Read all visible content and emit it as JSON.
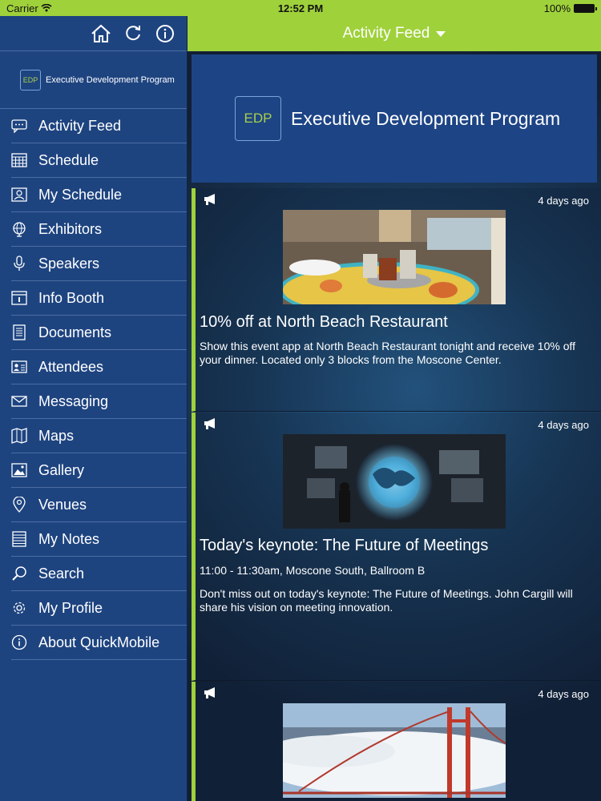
{
  "status": {
    "carrier": "Carrier",
    "time": "12:52 PM",
    "battery": "100%"
  },
  "header": {
    "title": "Activity Feed"
  },
  "sidebar": {
    "brand_badge": "EDP",
    "brand_name": "Executive Development Program",
    "items": [
      {
        "label": "Activity Feed",
        "icon": "chat-bubble-icon"
      },
      {
        "label": "Schedule",
        "icon": "calendar-icon"
      },
      {
        "label": "My Schedule",
        "icon": "person-calendar-icon"
      },
      {
        "label": "Exhibitors",
        "icon": "globe-icon"
      },
      {
        "label": "Speakers",
        "icon": "microphone-icon"
      },
      {
        "label": "Info Booth",
        "icon": "booth-icon"
      },
      {
        "label": "Documents",
        "icon": "document-icon"
      },
      {
        "label": "Attendees",
        "icon": "id-card-icon"
      },
      {
        "label": "Messaging",
        "icon": "envelope-icon"
      },
      {
        "label": "Maps",
        "icon": "map-icon"
      },
      {
        "label": "Gallery",
        "icon": "image-icon"
      },
      {
        "label": "Venues",
        "icon": "location-pin-icon"
      },
      {
        "label": "My Notes",
        "icon": "notes-icon"
      },
      {
        "label": "Search",
        "icon": "search-icon"
      },
      {
        "label": "My Profile",
        "icon": "gear-icon"
      },
      {
        "label": "About QuickMobile",
        "icon": "info-icon"
      }
    ]
  },
  "banner": {
    "badge": "EDP",
    "title": "Executive Development Program"
  },
  "feed": [
    {
      "time": "4 days ago",
      "title": "10% off at North Beach Restaurant",
      "body": "Show this event app at North Beach Restaurant tonight and receive 10% off your dinner. Located only 3 blocks from the Moscone Center."
    },
    {
      "time": "4 days ago",
      "title": "Today's keynote: The Future of Meetings",
      "meta": "11:00 - 11:30am, Moscone South, Ballroom B",
      "body": "Don't miss out on today's keynote: The Future of Meetings. John Cargill will share his vision on meeting innovation."
    },
    {
      "time": "4 days ago"
    }
  ],
  "colors": {
    "accent": "#9fd13b",
    "sidebar": "#1e4480",
    "banner": "#1d4485"
  }
}
